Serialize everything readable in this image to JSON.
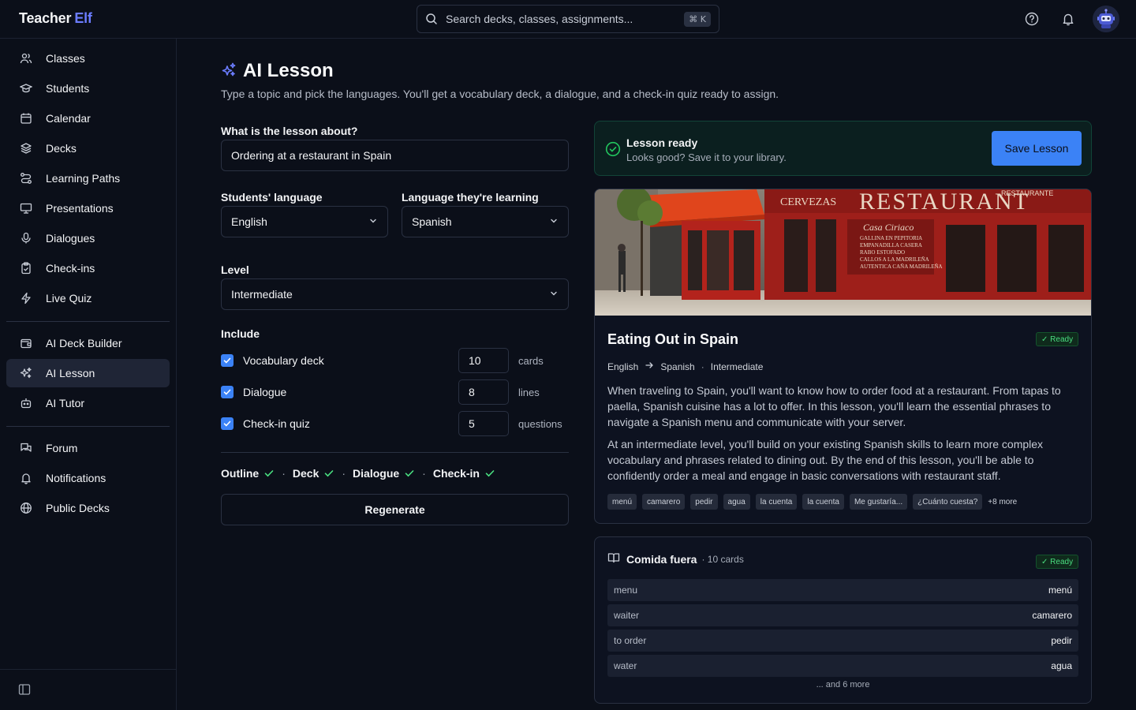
{
  "app": {
    "name": "Teacher",
    "name_accent": "Elf"
  },
  "search": {
    "placeholder": "Search decks, classes, assignments...",
    "shortcut": "⌘ K"
  },
  "sidebar": {
    "items": [
      {
        "label": "Classes",
        "icon": "users-icon"
      },
      {
        "label": "Students",
        "icon": "graduation-cap-icon"
      },
      {
        "label": "Calendar",
        "icon": "calendar-icon"
      },
      {
        "label": "Decks",
        "icon": "layers-icon"
      },
      {
        "label": "Learning Paths",
        "icon": "route-icon"
      },
      {
        "label": "Presentations",
        "icon": "presentation-icon"
      },
      {
        "label": "Dialogues",
        "icon": "microphone-icon"
      },
      {
        "label": "Check-ins",
        "icon": "clipboard-check-icon"
      },
      {
        "label": "Live Quiz",
        "icon": "bolt-icon"
      },
      {
        "label": "AI Deck Builder",
        "icon": "wallet-icon"
      },
      {
        "label": "AI Lesson",
        "icon": "sparkles-icon",
        "active": true
      },
      {
        "label": "AI Tutor",
        "icon": "bot-icon"
      },
      {
        "label": "Forum",
        "icon": "chat-icon"
      },
      {
        "label": "Notifications",
        "icon": "bell-icon"
      },
      {
        "label": "Public Decks",
        "icon": "globe-icon"
      }
    ]
  },
  "page": {
    "title": "AI Lesson",
    "subtitle": "Type a topic and pick the languages. You'll get a vocabulary deck, a dialogue, and a check-in quiz ready to assign."
  },
  "form": {
    "topic_label": "What is the lesson about?",
    "topic_value": "Ordering at a restaurant in Spain",
    "students_lang_label": "Students' language",
    "students_lang_value": "English",
    "target_lang_label": "Language they're learning",
    "target_lang_value": "Spanish",
    "level_label": "Level",
    "level_value": "Intermediate",
    "include_label": "Include",
    "includes": [
      {
        "label": "Vocabulary deck",
        "count": "10",
        "unit": "cards",
        "checked": true
      },
      {
        "label": "Dialogue",
        "count": "8",
        "unit": "lines",
        "checked": true
      },
      {
        "label": "Check-in quiz",
        "count": "5",
        "unit": "questions",
        "checked": true
      }
    ],
    "steps": [
      "Outline",
      "Deck",
      "Dialogue",
      "Check-in"
    ],
    "regenerate_label": "Regenerate"
  },
  "banner": {
    "title": "Lesson ready",
    "message": "Looks good? Save it to your library.",
    "save_label": "Save Lesson"
  },
  "lesson": {
    "title": "Eating Out in Spain",
    "badge": "✓ Ready",
    "from_lang": "English",
    "to_lang": "Spanish",
    "level": "Intermediate",
    "para1": "When traveling to Spain, you'll want to know how to order food at a restaurant. From tapas to paella, Spanish cuisine has a lot to offer. In this lesson, you'll learn the essential phrases to navigate a Spanish menu and communicate with your server.",
    "para2": "At an intermediate level, you'll build on your existing Spanish skills to learn more complex vocabulary and phrases related to dining out. By the end of this lesson, you'll be able to confidently order a meal and engage in basic conversations with restaurant staff.",
    "tags": [
      "menú",
      "camarero",
      "pedir",
      "agua",
      "la cuenta",
      "la cuenta",
      "Me gustaría...",
      "¿Cuánto cuesta?"
    ],
    "more_tags": "+8 more"
  },
  "deck": {
    "name": "Comida fuera",
    "count": "· 10 cards",
    "badge": "✓ Ready",
    "rows": [
      {
        "en": "menu",
        "es": "menú"
      },
      {
        "en": "waiter",
        "es": "camarero"
      },
      {
        "en": "to order",
        "es": "pedir"
      },
      {
        "en": "water",
        "es": "agua"
      }
    ],
    "more": "... and 6 more"
  },
  "colors": {
    "accent": "#6b7cff",
    "primary": "#3b82f6",
    "success": "#4ade80",
    "background": "#0b0f19"
  }
}
